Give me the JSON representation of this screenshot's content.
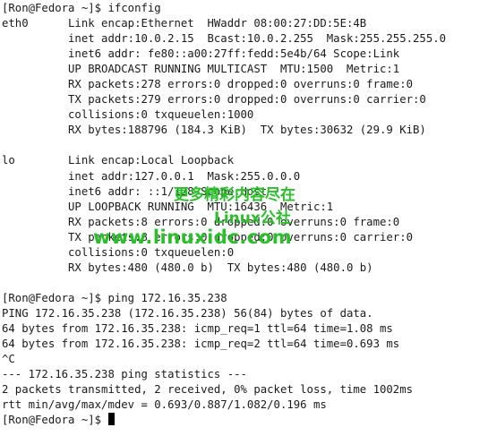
{
  "terminal": {
    "lines": [
      "[Ron@Fedora ~]$ ifconfig",
      "eth0      Link encap:Ethernet  HWaddr 08:00:27:DD:5E:4B",
      "          inet addr:10.0.2.15  Bcast:10.0.2.255  Mask:255.255.255.0",
      "          inet6 addr: fe80::a00:27ff:fedd:5e4b/64 Scope:Link",
      "          UP BROADCAST RUNNING MULTICAST  MTU:1500  Metric:1",
      "          RX packets:278 errors:0 dropped:0 overruns:0 frame:0",
      "          TX packets:279 errors:0 dropped:0 overruns:0 carrier:0",
      "          collisions:0 txqueuelen:1000",
      "          RX bytes:188796 (184.3 KiB)  TX bytes:30632 (29.9 KiB)",
      "",
      "lo        Link encap:Local Loopback",
      "          inet addr:127.0.0.1  Mask:255.0.0.0",
      "          inet6 addr: ::1/128 Scope:Host",
      "          UP LOOPBACK RUNNING  MTU:16436  Metric:1",
      "          RX packets:8 errors:0 dropped:0 overruns:0 frame:0",
      "          TX packets:8 errors:0 dropped:0 overruns:0 carrier:0",
      "          collisions:0 txqueuelen:0",
      "          RX bytes:480 (480.0 b)  TX bytes:480 (480.0 b)",
      "",
      "[Ron@Fedora ~]$ ping 172.16.35.238",
      "PING 172.16.35.238 (172.16.35.238) 56(84) bytes of data.",
      "64 bytes from 172.16.35.238: icmp_req=1 ttl=64 time=1.08 ms",
      "64 bytes from 172.16.35.238: icmp_req=2 ttl=64 time=0.693 ms",
      "^C",
      "--- 172.16.35.238 ping statistics ---",
      "2 packets transmitted, 2 received, 0% packet loss, time 1002ms",
      "rtt min/avg/max/mdev = 0.693/0.887/1.082/0.196 ms"
    ],
    "prompt": "[Ron@Fedora ~]$ "
  },
  "watermark": {
    "line1": "更多精彩内容尽在",
    "line2": "Linux公社",
    "line3": "www.linuxidc.com"
  },
  "colors": {
    "background": "#ffffff",
    "text": "#1a1a1a",
    "cursor": "#000000",
    "watermark": "#2bbf2b"
  }
}
